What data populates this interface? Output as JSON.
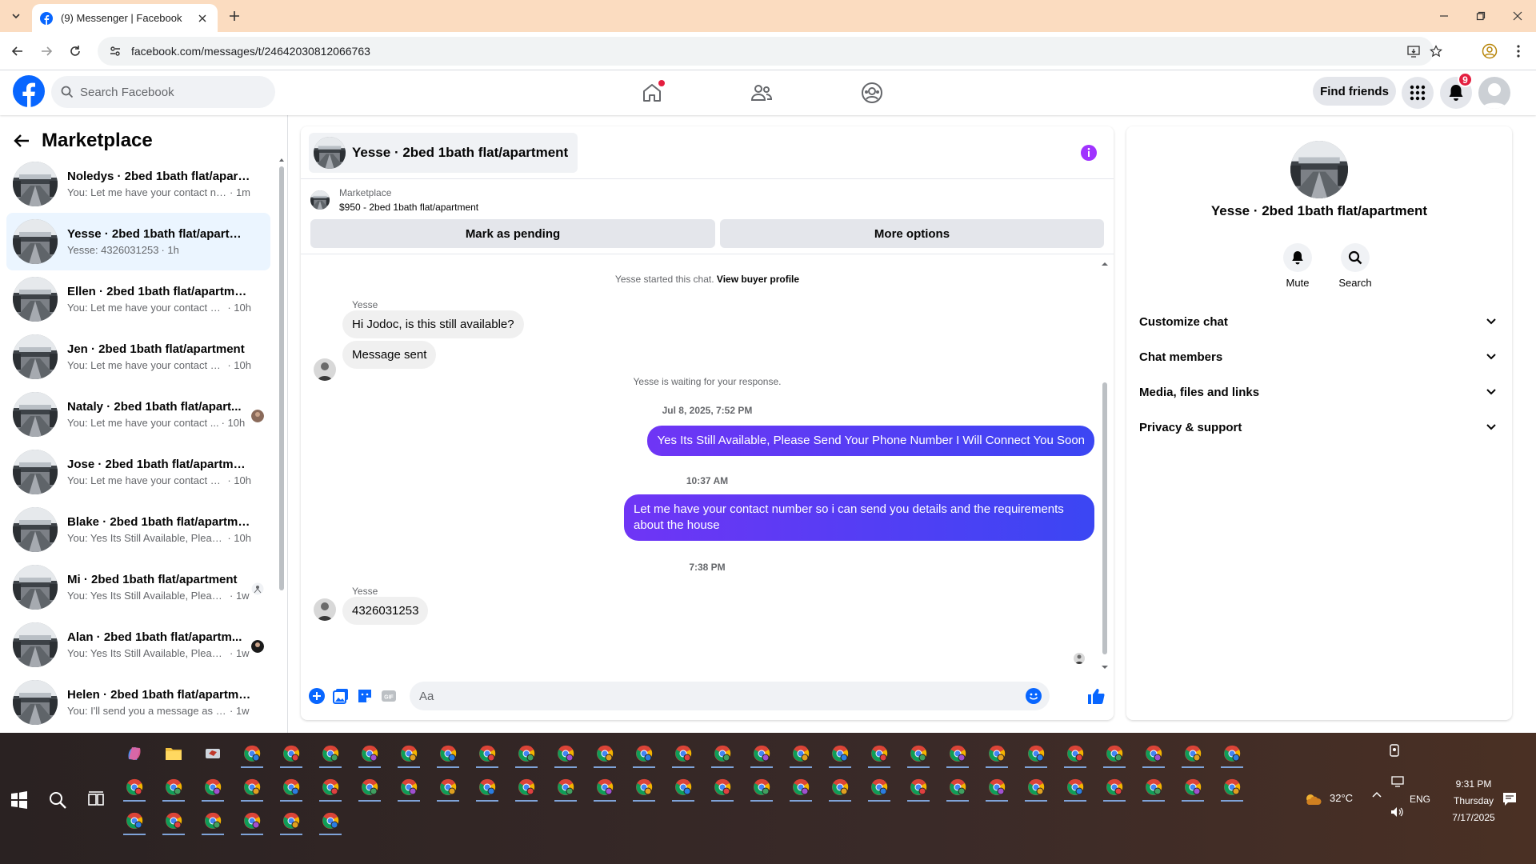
{
  "browser": {
    "tab_title": "(9) Messenger | Facebook",
    "url": "facebook.com/messages/t/24642030812066763"
  },
  "fb": {
    "search_placeholder": "Search Facebook",
    "find_friends": "Find friends",
    "notif_count": "9"
  },
  "left": {
    "title": "Marketplace",
    "conversations": [
      {
        "name": "Noledys · 2bed 1bath flat/apart...",
        "preview": "You: Let me have your contact nu...",
        "time": "· 1m"
      },
      {
        "name": "Yesse · 2bed 1bath flat/apartment",
        "preview": "Yesse: 4326031253",
        "time": "· 1h"
      },
      {
        "name": "Ellen · 2bed 1bath flat/apartment",
        "preview": "You: Let me have your contact nu...",
        "time": "· 10h"
      },
      {
        "name": "Jen · 2bed 1bath flat/apartment",
        "preview": "You: Let me have your contact nu...",
        "time": "· 10h"
      },
      {
        "name": "Nataly · 2bed 1bath flat/apart...",
        "preview": "You: Let me have your contact ...",
        "time": "· 10h"
      },
      {
        "name": "Jose · 2bed 1bath flat/apartment",
        "preview": "You: Let me have your contact nu...",
        "time": "· 10h"
      },
      {
        "name": "Blake · 2bed 1bath flat/apartment",
        "preview": "You: Yes Its Still Available, Please S...",
        "time": "· 10h"
      },
      {
        "name": "Mi · 2bed 1bath flat/apartment",
        "preview": "You: Yes Its Still Available, Please...",
        "time": "· 1w"
      },
      {
        "name": "Alan · 2bed 1bath flat/apartm...",
        "preview": "You: Yes Its Still Available, Please...",
        "time": "· 1w"
      },
      {
        "name": "Helen · 2bed 1bath flat/apartment",
        "preview": "You: I'll send you a message as soo...",
        "time": "· 1w"
      }
    ]
  },
  "chat": {
    "title": "Yesse · 2bed 1bath flat/apartment",
    "marketplace_label": "Marketplace",
    "listing": "$950 - 2bed 1bath flat/apartment",
    "mark_pending": "Mark as pending",
    "more_options": "More options",
    "started": "Yesse started this chat.",
    "view_profile": "View buyer profile",
    "sender1": "Yesse",
    "msg1": "Hi Jodoc, is this still available?",
    "msg2": "Message sent",
    "waiting": "Yesse is waiting for your response.",
    "ts1": "Jul 8, 2025, 7:52 PM",
    "out1": "Yes Its Still Available, Please Send Your Phone Number I Will Connect You Soon",
    "ts2": "10:37 AM",
    "out2": "Let me have your contact number so i can send you details and the requirements about the house",
    "ts3": "7:38 PM",
    "sender2": "Yesse",
    "msg3": "4326031253",
    "input_placeholder": "Aa"
  },
  "right": {
    "name": "Yesse · 2bed 1bath flat/apartment",
    "mute": "Mute",
    "search": "Search",
    "sections": [
      "Customize chat",
      "Chat members",
      "Media, files and links",
      "Privacy & support"
    ]
  },
  "taskbar": {
    "temperature": "32°C",
    "lang": "ENG",
    "time": "9:31 PM",
    "day": "Thursday",
    "date": "7/17/2025"
  },
  "colors": {
    "fb_blue": "#0866ff",
    "messenger_purple": "#5b3cf5",
    "info_purple": "#a033ff",
    "badge_red": "#e41e3f"
  }
}
